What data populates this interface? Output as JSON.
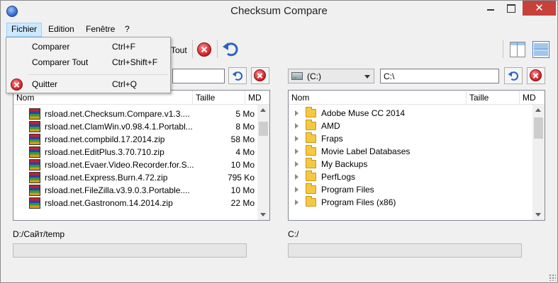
{
  "window": {
    "title": "Checksum Compare"
  },
  "menu": {
    "file": "Fichier",
    "edit": "Edition",
    "window": "Fenêtre",
    "help": "?"
  },
  "file_menu": {
    "items": [
      {
        "label": "Comparer",
        "shortcut": "Ctrl+F"
      },
      {
        "label": "Comparer Tout",
        "shortcut": "Ctrl+Shift+F"
      },
      {
        "label": "Quitter",
        "shortcut": "Ctrl+Q"
      }
    ]
  },
  "toolbar": {
    "compare_all_partial": "Tout"
  },
  "left": {
    "path": "",
    "columns": [
      "Nom",
      "Taille",
      "MD"
    ],
    "rows": [
      {
        "name": "rsload.net.Checksum.Compare.v1.3....",
        "size": "5 Mo"
      },
      {
        "name": "rsload.net.ClamWin.v0.98.4.1.Portabl...",
        "size": "8 Mo"
      },
      {
        "name": "rsload.net.compbild.17.2014.zip",
        "size": "58 Mo"
      },
      {
        "name": "rsload.net.EditPlus.3.70.710.zip",
        "size": "4 Mo"
      },
      {
        "name": "rsload.net.Evaer.Video.Recorder.for.S...",
        "size": "10 Mo"
      },
      {
        "name": "rsload.net.Express.Burn.4.72.zip",
        "size": "795 Ko"
      },
      {
        "name": "rsload.net.FileZilla.v3.9.0.3.Portable....",
        "size": "10 Mo"
      },
      {
        "name": "rsload.net.Gastronom.14.2014.zip",
        "size": "22 Mo"
      }
    ],
    "status_path": "D:/Сайт/temp",
    "progress": 0
  },
  "right": {
    "drive": "(C:)",
    "path": "C:\\",
    "columns": [
      "Nom",
      "Taille",
      "MD"
    ],
    "rows": [
      {
        "name": "Adobe Muse CC 2014"
      },
      {
        "name": "AMD"
      },
      {
        "name": "Fraps"
      },
      {
        "name": "Movie Label Databases"
      },
      {
        "name": "My Backups"
      },
      {
        "name": "PerfLogs"
      },
      {
        "name": "Program Files"
      },
      {
        "name": "Program Files (x86)"
      }
    ],
    "status_path": "C:/",
    "progress": 0
  }
}
